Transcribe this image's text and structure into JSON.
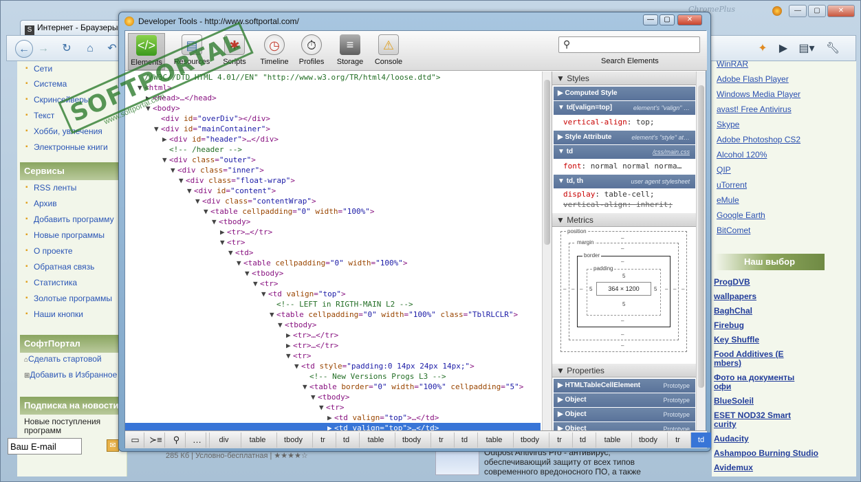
{
  "browser": {
    "tab_title": "Интернет - Браузеры",
    "tab_favicon": "S",
    "brand": "ChromePlus"
  },
  "left": {
    "categories": [
      "Сети",
      "Система",
      "Скринсейверы",
      "Текст",
      "Хобби, увлечения",
      "Электронные книги"
    ],
    "services_title": "Сервисы",
    "services": [
      "RSS ленты",
      "Архив",
      "Добавить программу",
      "Новые программы",
      "О проекте",
      "Обратная связь",
      "Статистика",
      "Золотые программы",
      "Наши кнопки"
    ],
    "softportal_title": "СофтПортал",
    "softportal_links": [
      "Сделать стартовой",
      "Добавить в Избранное"
    ],
    "subscribe_title": "Подписка на новости",
    "subscribe_text": "Новые поступления программ",
    "email_placeholder": "Ваш E-mail"
  },
  "right": {
    "links": [
      "WinRAR",
      "Adobe Flash Player",
      "Windows Media Player",
      "avast! Free Antivirus",
      "Skype",
      "Adobe Photoshop CS2",
      "Alcohol 120%",
      "QIP",
      "uTorrent",
      "eMule",
      "Google Earth",
      "BitComet"
    ],
    "choice_title": "Наш выбор",
    "choice_links": [
      "ProgDVB",
      "wallpapers",
      "BaghChal",
      "Firebug",
      "Key Shuffle",
      "Food Additives (E",
      "mbers)",
      "Фото на документы",
      "офи",
      "BlueSoleil",
      "ESET NOD32 Smart",
      "curity",
      "Audacity",
      "Ashampoo Burning Studio",
      "Avidemux"
    ]
  },
  "bottom": {
    "size_info": "285 Кб | Условно-бесплатная | ★★★★☆",
    "article_title": "Outpost Antivirus Pro - антивирус,",
    "article_text": "обеспечивающий защиту от всех типов современного вредоносного ПО, а также"
  },
  "stamp": {
    "main": "SOFTPORTAL",
    "sub": "www.softportal.com"
  },
  "devtools": {
    "title": "Developer Tools - http://www.softportal.com/",
    "tools": [
      {
        "label": "Elements",
        "icon": "elements-icon"
      },
      {
        "label": "Resources",
        "icon": "resources-icon"
      },
      {
        "label": "Scripts",
        "icon": "scripts-icon"
      },
      {
        "label": "Timeline",
        "icon": "timeline-icon"
      },
      {
        "label": "Profiles",
        "icon": "profiles-icon"
      },
      {
        "label": "Storage",
        "icon": "storage-icon"
      },
      {
        "label": "Console",
        "icon": "console-icon"
      }
    ],
    "search_label": "Search Elements",
    "dom_lines": [
      {
        "depth": 1,
        "arrow": "",
        "html": "<span class=\"cm\">//W3C//DTD HTML 4.01//EN\" \"http://www.w3.org/TR/html4/loose.dtd\"></span>"
      },
      {
        "depth": 1,
        "arrow": "▼",
        "html": "<span class=\"tag\">&lt;html&gt;</span>"
      },
      {
        "depth": 2,
        "arrow": "▶",
        "html": "<span class=\"tag\">&lt;head&gt;</span>…<span class=\"tag\">&lt;/head&gt;</span>"
      },
      {
        "depth": 2,
        "arrow": "▼",
        "html": "<span class=\"tag\">&lt;body&gt;</span>"
      },
      {
        "depth": 3,
        "arrow": "",
        "html": "<span class=\"tag\">&lt;div </span><span class=\"an\">id</span>=<span class=\"av\">\"overDiv\"</span><span class=\"tag\">&gt;&lt;/div&gt;</span>"
      },
      {
        "depth": 3,
        "arrow": "▼",
        "html": "<span class=\"tag\">&lt;div </span><span class=\"an\">id</span>=<span class=\"av\">\"mainContainer\"</span><span class=\"tag\">&gt;</span>"
      },
      {
        "depth": 4,
        "arrow": "▶",
        "html": "<span class=\"tag\">&lt;div </span><span class=\"an\">id</span>=<span class=\"av\">\"header\"</span><span class=\"tag\">&gt;</span>…<span class=\"tag\">&lt;/div&gt;</span>"
      },
      {
        "depth": 4,
        "arrow": "",
        "html": "<span class=\"cm\">&lt;!-- /header --&gt;</span>"
      },
      {
        "depth": 4,
        "arrow": "▼",
        "html": "<span class=\"tag\">&lt;div </span><span class=\"an\">class</span>=<span class=\"av\">\"outer\"</span><span class=\"tag\">&gt;</span>"
      },
      {
        "depth": 5,
        "arrow": "▼",
        "html": "<span class=\"tag\">&lt;div </span><span class=\"an\">class</span>=<span class=\"av\">\"inner\"</span><span class=\"tag\">&gt;</span>"
      },
      {
        "depth": 6,
        "arrow": "▼",
        "html": "<span class=\"tag\">&lt;div </span><span class=\"an\">class</span>=<span class=\"av\">\"float-wrap\"</span><span class=\"tag\">&gt;</span>"
      },
      {
        "depth": 7,
        "arrow": "▼",
        "html": "<span class=\"tag\">&lt;div </span><span class=\"an\">id</span>=<span class=\"av\">\"content\"</span><span class=\"tag\">&gt;</span>"
      },
      {
        "depth": 8,
        "arrow": "▼",
        "html": "<span class=\"tag\">&lt;div </span><span class=\"an\">class</span>=<span class=\"av\">\"contentWrap\"</span><span class=\"tag\">&gt;</span>"
      },
      {
        "depth": 9,
        "arrow": "▼",
        "html": "<span class=\"tag\">&lt;table </span><span class=\"an\">cellpadding</span>=<span class=\"av\">\"0\"</span> <span class=\"an\">width</span>=<span class=\"av\">\"100%\"</span><span class=\"tag\">&gt;</span>"
      },
      {
        "depth": 10,
        "arrow": "▼",
        "html": "<span class=\"tag\">&lt;tbody&gt;</span>"
      },
      {
        "depth": 11,
        "arrow": "▶",
        "html": "<span class=\"tag\">&lt;tr&gt;</span>…<span class=\"tag\">&lt;/tr&gt;</span>"
      },
      {
        "depth": 11,
        "arrow": "▼",
        "html": "<span class=\"tag\">&lt;tr&gt;</span>"
      },
      {
        "depth": 12,
        "arrow": "▼",
        "html": "<span class=\"tag\">&lt;td&gt;</span>"
      },
      {
        "depth": 13,
        "arrow": "▼",
        "html": "<span class=\"tag\">&lt;table </span><span class=\"an\">cellpadding</span>=<span class=\"av\">\"0\"</span> <span class=\"an\">width</span>=<span class=\"av\">\"100%\"</span><span class=\"tag\">&gt;</span>"
      },
      {
        "depth": 14,
        "arrow": "▼",
        "html": "<span class=\"tag\">&lt;tbody&gt;</span>"
      },
      {
        "depth": 15,
        "arrow": "▼",
        "html": "<span class=\"tag\">&lt;tr&gt;</span>"
      },
      {
        "depth": 16,
        "arrow": "▼",
        "html": "<span class=\"tag\">&lt;td </span><span class=\"an\">valign</span>=<span class=\"av\">\"top\"</span><span class=\"tag\">&gt;</span>"
      },
      {
        "depth": 17,
        "arrow": "",
        "html": "<span class=\"cm\">&lt;!-- LEFT in RIGTH-MAIN L2 --&gt;</span>"
      },
      {
        "depth": 17,
        "arrow": "▼",
        "html": "<span class=\"tag\">&lt;table </span><span class=\"an\">cellpadding</span>=<span class=\"av\">\"0\"</span> <span class=\"an\">width</span>=<span class=\"av\">\"100%\"</span> <span class=\"an\">class</span>=<span class=\"av\">\"TblRLCLR\"</span><span class=\"tag\">&gt;</span>"
      },
      {
        "depth": 18,
        "arrow": "▼",
        "html": "<span class=\"tag\">&lt;tbody&gt;</span>"
      },
      {
        "depth": 19,
        "arrow": "▶",
        "html": "<span class=\"tag\">&lt;tr&gt;</span>…<span class=\"tag\">&lt;/tr&gt;</span>"
      },
      {
        "depth": 19,
        "arrow": "▶",
        "html": "<span class=\"tag\">&lt;tr&gt;</span>…<span class=\"tag\">&lt;/tr&gt;</span>"
      },
      {
        "depth": 19,
        "arrow": "▼",
        "html": "<span class=\"tag\">&lt;tr&gt;</span>"
      },
      {
        "depth": 20,
        "arrow": "▼",
        "html": "<span class=\"tag\">&lt;td </span><span class=\"an\">style</span>=<span class=\"av\">\"padding:0 14px 24px 14px;\"</span><span class=\"tag\">&gt;</span>"
      },
      {
        "depth": 21,
        "arrow": "",
        "html": "<span class=\"cm\">&lt;!-- New Versions Progs L3 --&gt;</span>"
      },
      {
        "depth": 21,
        "arrow": "▼",
        "html": "<span class=\"tag\">&lt;table </span><span class=\"an\">border</span>=<span class=\"av\">\"0\"</span> <span class=\"an\">width</span>=<span class=\"av\">\"100%\"</span> <span class=\"an\">cellpadding</span>=<span class=\"av\">\"5\"</span><span class=\"tag\">&gt;</span>"
      },
      {
        "depth": 22,
        "arrow": "▼",
        "html": "<span class=\"tag\">&lt;tbody&gt;</span>"
      },
      {
        "depth": 23,
        "arrow": "▼",
        "html": "<span class=\"tag\">&lt;tr&gt;</span>"
      },
      {
        "depth": 24,
        "arrow": "▶",
        "html": "<span class=\"tag\">&lt;td </span><span class=\"an\">valign</span>=<span class=\"av\">\"top\"</span><span class=\"tag\">&gt;</span>…<span class=\"tag\">&lt;/td&gt;</span>"
      },
      {
        "depth": 24,
        "arrow": "▶",
        "html": "<span class=\"tag\">&lt;td </span><span class=\"an\">valign</span>=<span class=\"av\">\"top\"</span><span class=\"tag\">&gt;</span>…<span class=\"tag\">&lt;/td&gt;</span>",
        "selected": true
      }
    ],
    "sidebar": {
      "styles_title": "Styles",
      "computed_style": "Computed Style",
      "rule1_selector": "td[valign=top]",
      "rule1_source": "element's \"valign\" …",
      "rule1_prop_name": "vertical-align",
      "rule1_prop_value": "top;",
      "style_attr": "Style Attribute",
      "style_attr_source": "element's \"style\" at…",
      "rule2_selector": "td",
      "rule2_source": "/css/main.css",
      "rule2_prop_name": "font",
      "rule2_prop_value": "normal normal norma…",
      "rule3_selector": "td, th",
      "rule3_source": "user agent stylesheet",
      "rule3_prop1_name": "display",
      "rule3_prop1_value": "table-cell;",
      "rule3_prop2_name": "vertical-align",
      "rule3_prop2_value": "inherit;",
      "metrics_title": "Metrics",
      "metrics": {
        "position_label": "position",
        "margin_label": "margin",
        "border_label": "border",
        "padding_label": "padding",
        "dash": "–",
        "padding_value": "5",
        "content_size": "364 × 1200"
      },
      "properties_title": "Properties",
      "properties": [
        {
          "name": "HTMLTableCellElement",
          "proto": "Prototype"
        },
        {
          "name": "Object",
          "proto": "Prototype"
        },
        {
          "name": "Object",
          "proto": "Prototype"
        },
        {
          "name": "Object",
          "proto": "Prototype"
        }
      ]
    },
    "breadcrumbs": [
      "div",
      "table",
      "tbody",
      "tr",
      "td",
      "table",
      "tbody",
      "tr",
      "td",
      "table",
      "tbody",
      "tr",
      "td",
      "table",
      "tbody",
      "tr",
      "td"
    ]
  }
}
